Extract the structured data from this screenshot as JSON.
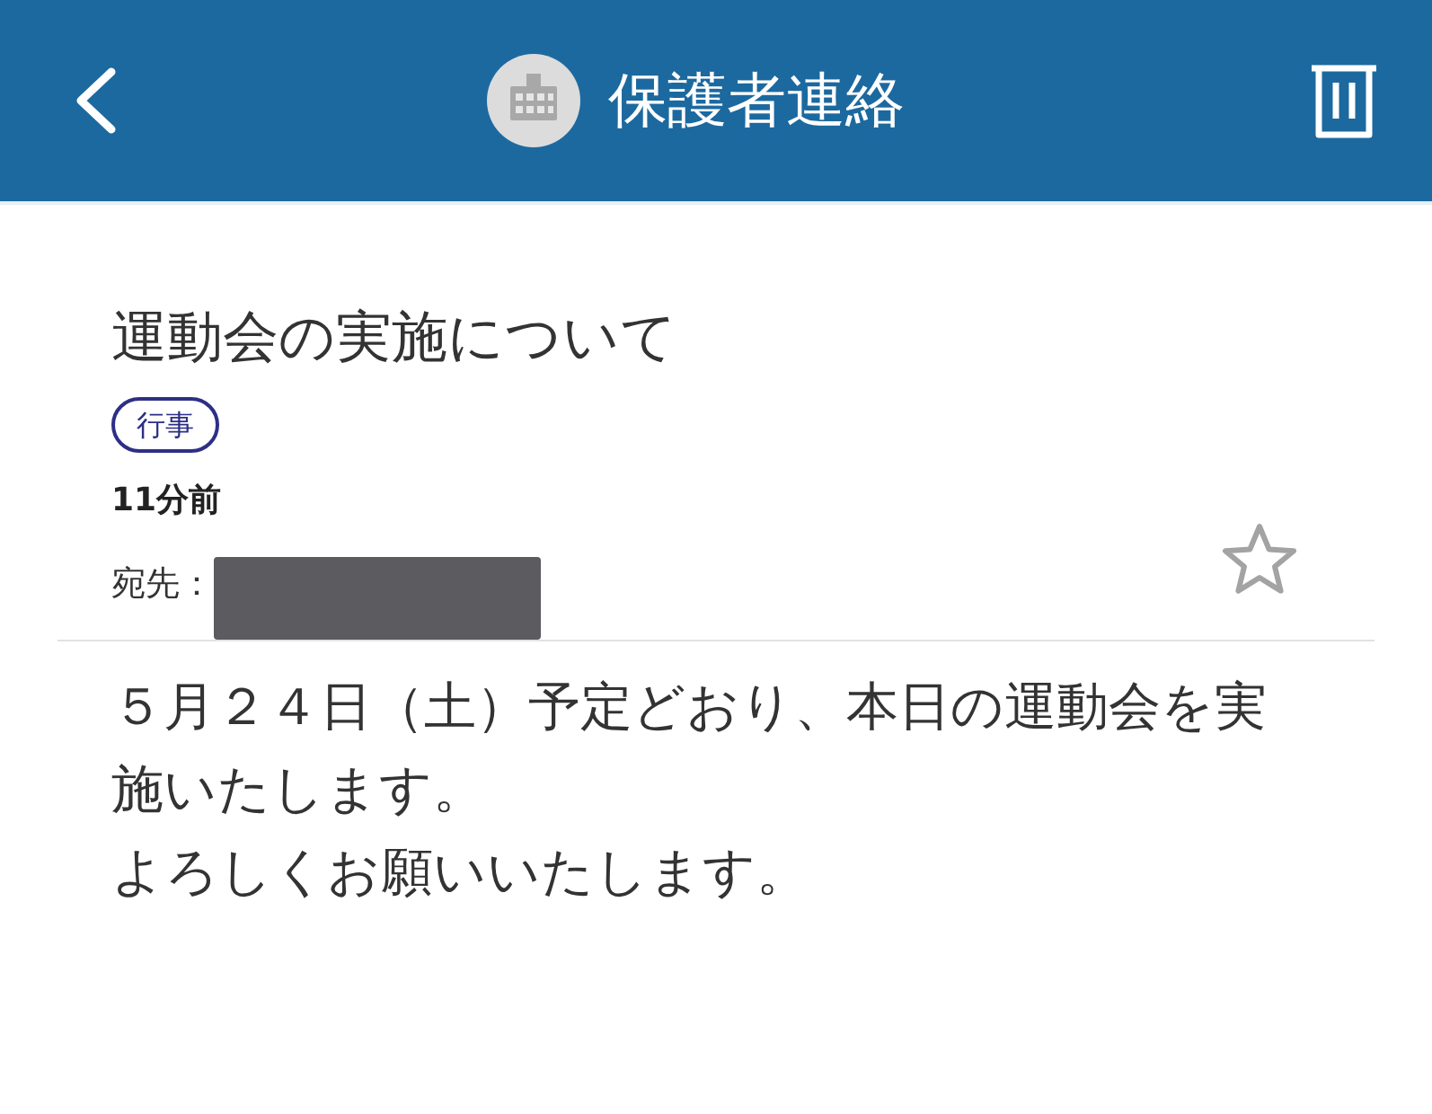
{
  "header": {
    "title": "保護者連絡"
  },
  "message": {
    "title": "運動会の実施について",
    "tags": [
      "行事"
    ],
    "time": "11分前",
    "recipient": {
      "label": "宛先：",
      "redacted": true
    },
    "starred": false,
    "body": [
      "５月２４日（土）予定どおり、本日の運動会を実施いたします。",
      "よろしくお願いいたします。"
    ]
  }
}
